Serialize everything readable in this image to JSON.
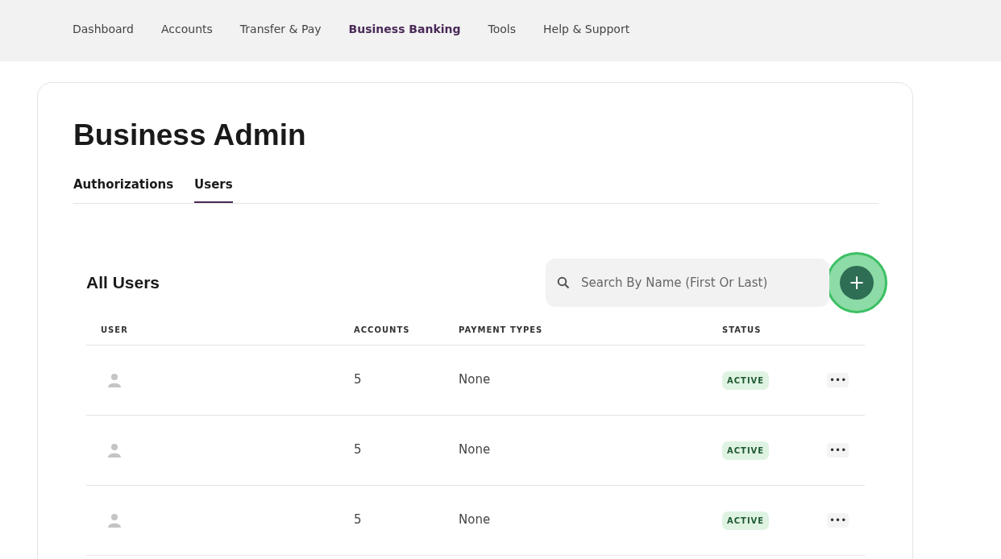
{
  "nav": [
    {
      "label": "Dashboard",
      "selected": false
    },
    {
      "label": "Accounts",
      "selected": false
    },
    {
      "label": "Transfer & Pay",
      "selected": false
    },
    {
      "label": "Business Banking",
      "selected": true
    },
    {
      "label": "Tools",
      "selected": false
    },
    {
      "label": "Help & Support",
      "selected": false
    }
  ],
  "page_title": "Business Admin",
  "tabs": [
    {
      "label": "Authorizations",
      "selected": false
    },
    {
      "label": "Users",
      "selected": true
    }
  ],
  "section_title": "All Users",
  "search": {
    "placeholder": "Search By Name (First Or Last)"
  },
  "add_button": {
    "label": "+",
    "highlighted": true
  },
  "table": {
    "columns": [
      "USER",
      "ACCOUNTS",
      "PAYMENT TYPES",
      "STATUS"
    ],
    "rows": [
      {
        "accounts": "5",
        "payment_types": "None",
        "status": "ACTIVE",
        "menu": "•••"
      },
      {
        "accounts": "5",
        "payment_types": "None",
        "status": "ACTIVE",
        "menu": "•••"
      },
      {
        "accounts": "5",
        "payment_types": "None",
        "status": "ACTIVE",
        "menu": "•••"
      }
    ]
  }
}
